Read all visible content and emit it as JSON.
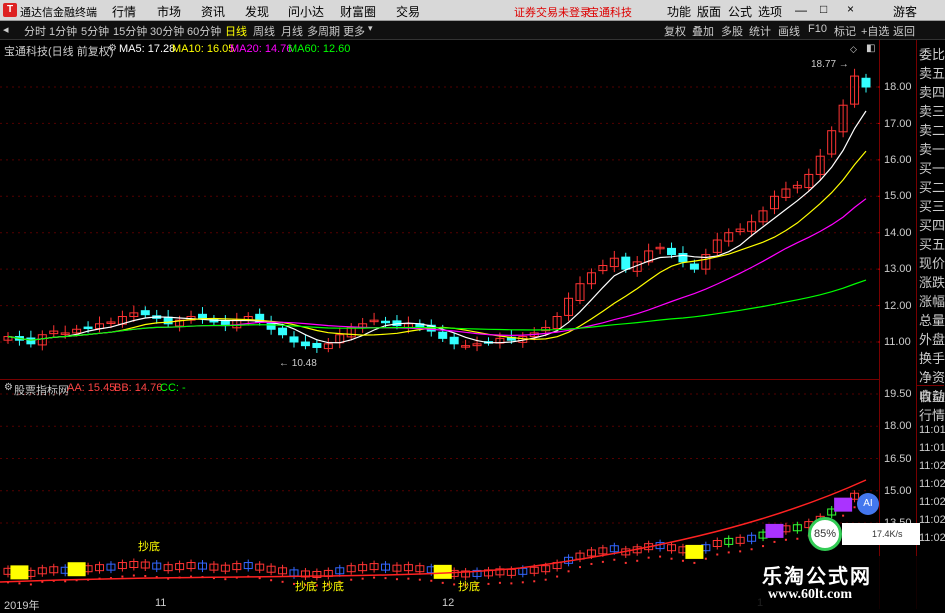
{
  "titlebar": {
    "app_icon": "T",
    "app_title": "通达信金融终端",
    "menu": [
      "行情",
      "市场",
      "资讯",
      "发现",
      "问小达",
      "财富圈",
      "交易"
    ],
    "notice": "证券交易未登录",
    "stock_name": "宝通科技",
    "right_menu": [
      "功能",
      "版面",
      "公式",
      "选项"
    ],
    "guest": "游客"
  },
  "toolbar": {
    "periods": [
      "分时",
      "1分钟",
      "5分钟",
      "15分钟",
      "30分钟",
      "60分钟",
      "日线",
      "周线",
      "月线",
      "多周期",
      "更多"
    ],
    "active_period": "日线",
    "tools": [
      "复权",
      "叠加",
      "多股",
      "统计",
      "画线",
      "F10",
      "标记",
      "+自选",
      "返回"
    ]
  },
  "main_chart": {
    "legend_stock": "宝通科技(日线 前复权)",
    "ma5": "MA5: 17.28",
    "ma10": "MA10: 16.05",
    "ma20": "MA20: 14.76",
    "ma60": "MA60: 12.60",
    "colors": {
      "ma5": "#ffffff",
      "ma10": "#ffff00",
      "ma20": "#ff00ff",
      "ma60": "#00ff00",
      "up": "#ff3333",
      "down": "#33ffff"
    },
    "price_axis": [
      "18.00",
      "17.00",
      "16.00",
      "15.00",
      "14.00",
      "13.00",
      "12.00",
      "11.00"
    ],
    "high_marker": "18.77",
    "low_marker": "10.48"
  },
  "sub_chart": {
    "title": "股票指标网",
    "aa": "AA: 15.45",
    "bb": "BB: 14.76",
    "cc": "CC: -",
    "price_axis": [
      "19.50",
      "18.00",
      "16.50",
      "15.00",
      "13.50"
    ],
    "annotations": [
      "抄底",
      "抄底",
      "抄底",
      "抄底"
    ]
  },
  "side_panel": {
    "items": [
      "委比",
      "卖五",
      "卖四",
      "卖三",
      "卖二",
      "卖一",
      "买一",
      "买二",
      "买三",
      "买四",
      "买五",
      "现价",
      "涨跌",
      "涨幅",
      "总量",
      "外盘",
      "换手",
      "净资",
      "收益"
    ],
    "lower_items": [
      "自动",
      "行情"
    ],
    "times": [
      "11:01",
      "11:01",
      "11:02",
      "11:02",
      "11:02",
      "11:02",
      "11:02"
    ]
  },
  "dates": [
    "2019年",
    "11",
    "12",
    "1"
  ],
  "overlay": {
    "ai_label": "AI",
    "speed_pct": "85%",
    "speed_rate": "17.4K/s"
  },
  "watermark": {
    "main": "乐淘公式网",
    "url": "www.60lt.com"
  }
}
